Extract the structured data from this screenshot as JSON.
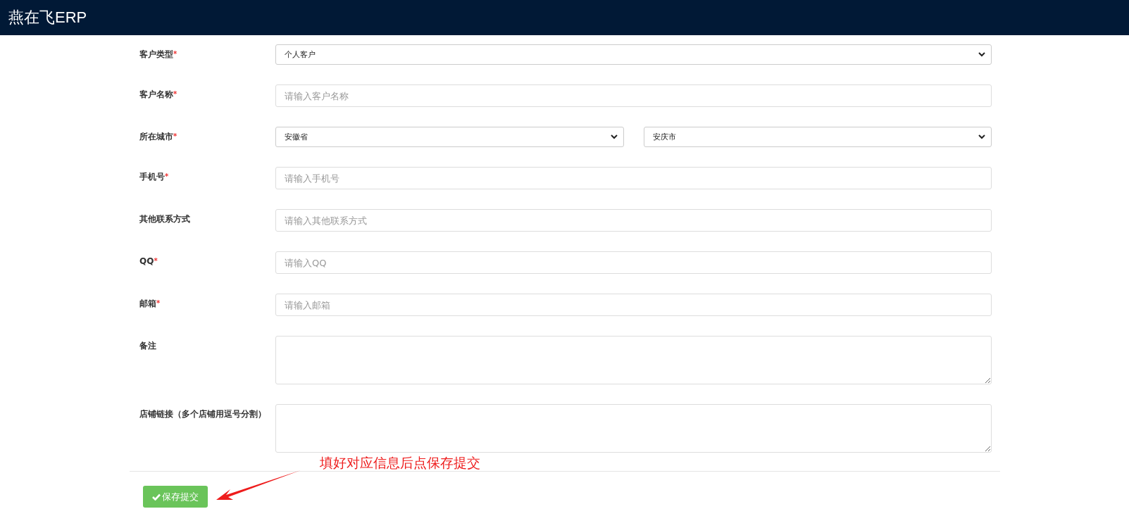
{
  "header": {
    "title": "燕在飞ERP"
  },
  "fields": [
    {
      "kind": "select",
      "label": "客户类型",
      "required_mark": "*",
      "values": [
        "个人客户"
      ]
    },
    {
      "kind": "input",
      "label": "客户名称",
      "required_mark": "*",
      "placeholder": "请输入客户名称"
    },
    {
      "kind": "select",
      "label": "所在城市",
      "required_mark": "*",
      "values": [
        "安徽省",
        "安庆市"
      ]
    },
    {
      "kind": "input",
      "label": "手机号",
      "required_mark": "*",
      "placeholder": "请输入手机号"
    },
    {
      "kind": "input",
      "label": "其他联系方式",
      "placeholder": "请输入其他联系方式"
    },
    {
      "kind": "input",
      "label": "QQ",
      "required_mark": "*",
      "placeholder": "请输入QQ"
    },
    {
      "kind": "input",
      "label": "邮箱",
      "required_mark": "*",
      "placeholder": "请输入邮箱"
    },
    {
      "kind": "textarea",
      "label": "备注"
    },
    {
      "kind": "textarea",
      "label": "店铺链接（多个店铺用逗号分割）"
    }
  ],
  "submit_button": {
    "label": "保存提交"
  },
  "annotation": {
    "text": "填好对应信息后点保存提交"
  }
}
